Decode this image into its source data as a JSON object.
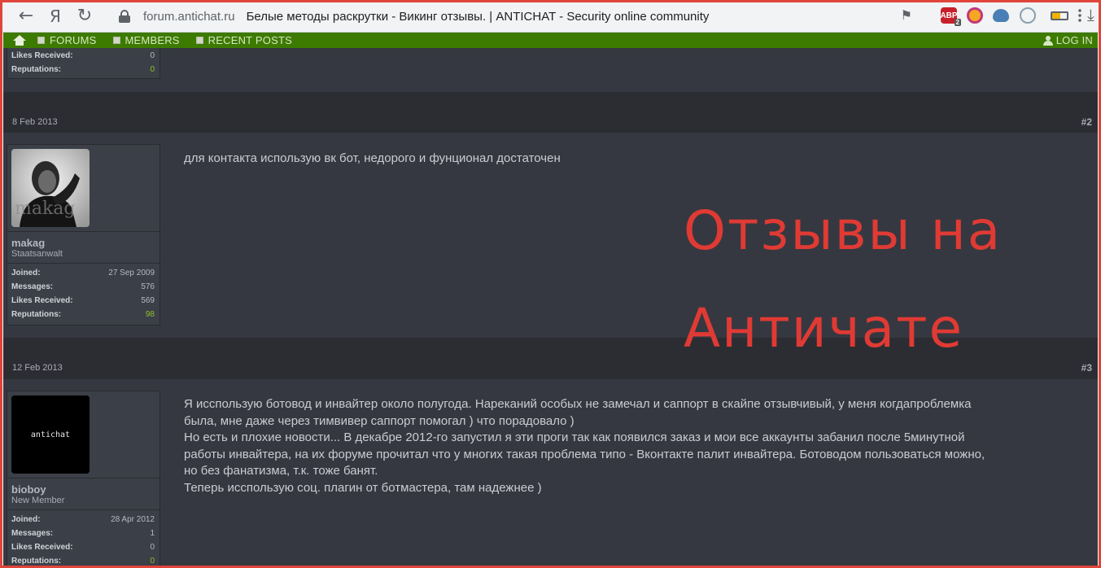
{
  "browser": {
    "url_domain": "forum.antichat.ru",
    "page_title": "Белые методы раскрутки - Викинг отзывы. | ANTICHAT - Security online community",
    "yandex_label": "Я",
    "abp_badge": "ABP",
    "abp_count": "2"
  },
  "site_nav": {
    "forums": "FORUMS",
    "members": "MEMBERS",
    "recent_posts": "RECENT POSTS",
    "login": "LOG IN",
    "brand_color": "#3d7a00"
  },
  "prev_post": {
    "stats": [
      {
        "label": "Likes Received:",
        "value": "0"
      },
      {
        "label": "Reputations:",
        "value": "0"
      }
    ]
  },
  "posts": [
    {
      "date": "8 Feb 2013",
      "number": "#2",
      "username": "makag",
      "user_title": "Staatsanwalt",
      "avatar_label": "makag",
      "stats": [
        {
          "label": "Joined:",
          "value": "27 Sep 2009"
        },
        {
          "label": "Messages:",
          "value": "576"
        },
        {
          "label": "Likes Received:",
          "value": "569"
        },
        {
          "label": "Reputations:",
          "value": "98"
        }
      ],
      "message": [
        "для контакта использую вк бот, недорого и фунционал достаточен"
      ]
    },
    {
      "date": "12 Feb 2013",
      "number": "#3",
      "username": "bioboy",
      "user_title": "New Member",
      "avatar_label": "antichat",
      "stats": [
        {
          "label": "Joined:",
          "value": "28 Apr 2012"
        },
        {
          "label": "Messages:",
          "value": "1"
        },
        {
          "label": "Likes Received:",
          "value": "0"
        },
        {
          "label": "Reputations:",
          "value": "0"
        }
      ],
      "message": [
        "Я исспользую ботовод и инвайтер около полугода. Нареканий особых не замечал и саппорт в скайпе отзывчивый, у меня когдапроблемка",
        "была, мне даже через тимвивер саппорт помогал ) что порадовало )",
        "Но есть и плохие новости... В декабре 2012-го запустил я эти проги так как появился заказ и мои все аккаунты забанил после 5минутной",
        "работы инвайтера, на их форуме прочитал что у многих такая проблема типо - Вконтакте палит инвайтера. Ботоводом пользоваться можно,",
        "но без фанатизма, т.к. тоже банят.",
        "Теперь исспользую соц. плагин от ботмастера, там надежнее )"
      ]
    }
  ],
  "overlay": {
    "line1": "Отзывы на",
    "line2": "Античате",
    "color": "#e03a34"
  }
}
